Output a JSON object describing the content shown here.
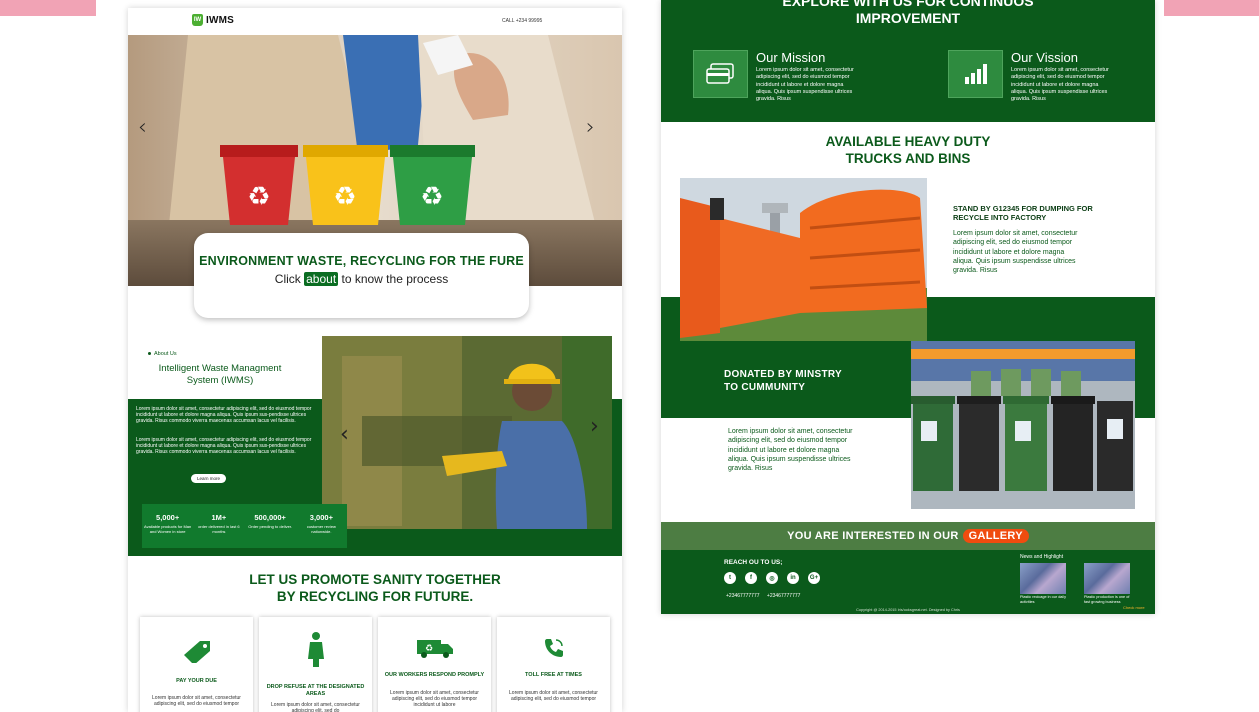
{
  "colors": {
    "brand_green": "#0b5a1b",
    "accent_orange": "#f04c0f",
    "band_green": "#4d7d43",
    "pink_bar": "#f1a3b5"
  },
  "left_page": {
    "nav": {
      "logo_text": "IWMS",
      "logo_mark": "IW",
      "call": "CALL +234 99995"
    },
    "hero": {
      "prev_arrow": "‹",
      "next_arrow": "›",
      "title": "ENVIRONMENT WASTE, RECYCLING FOR THE FURE",
      "sub_before": "Click ",
      "sub_highlight": "about",
      "sub_after": " to know the process"
    },
    "about": {
      "tag": "About Us",
      "title": "Intelligent Waste Managment System (IWMS)",
      "para1": "Lorem ipsum dolor sit amet, consectetur adipiscing elit, sed do eiusmod tempor incididunt ut labore et dolore magna aliqua. Quis ipsum sus-pendisse ultrices gravida. Risus commodo viverra maecenas accumsan lacus vel facilisis.",
      "para2": "Lorem ipsum dolor sit amet, consectetur adipiscing elit, sed do eiusmod tempor incididunt ut labore et dolore magna aliqua. Quis ipsum sus-pendisse ultrices gravida. Risus commodo viverra maecenas accumsan lacus vel facilisis.",
      "learn_more": "Learn more",
      "stats": [
        {
          "num": "5,000+",
          "label": "Available products for Man and Women in store"
        },
        {
          "num": "1M+",
          "label": "order delivered in last 6 months"
        },
        {
          "num": "500,000+",
          "label": "Order pending to deliver."
        },
        {
          "num": "3,000+",
          "label": "customer review nationwide."
        }
      ]
    },
    "promote": {
      "line1": "LET US PROMOTE SANITY TOGETHER",
      "line2": "BY RECYCLING FOR FUTURE."
    },
    "cards": [
      {
        "icon": "tag-icon",
        "title": "PAY YOUR DUE",
        "text": "Lorem ipsum dolor sit amet, consectetur adipiscing elit, sed do eiusmod tempor"
      },
      {
        "icon": "person-icon",
        "title": "DROP REFUSE AT THE DESIGNATED AREAS",
        "text": "Lorem ipsum dolor sit amet, consectetur adipiscing elit, sed do"
      },
      {
        "icon": "recycle-truck-icon",
        "title": "OUR WORKERS RESPOND PROMPLY",
        "text": "Lorem ipsum dolor sit amet, consectetur adipiscing elit, sed do eiusmod tempor incididunt ut labore"
      },
      {
        "icon": "phone-icon",
        "title": "TOLL FREE AT TIMES",
        "text": "Lorem ipsum dolor sit amet, consectetur adipiscing elit, sed do eiusmod tempor"
      }
    ]
  },
  "right_page": {
    "explore": {
      "line1": "EXPLORE WITH US FOR CONTINUOS",
      "line2": "IMPROVEMENT"
    },
    "mission": {
      "title": "Our Mission",
      "text": "Lorem ipsum dolor sit amet, consectetur adipiscing elit, sed do eiusmod tempor incididunt ut labore et dolore magna aliqua. Quis ipsum suspendisse ultrices gravida. Risus"
    },
    "vision": {
      "title": "Our Vission",
      "text": "Lorem ipsum dolor sit amet, consectetur adipiscing elit, sed do eiusmod tempor incididunt ut labore et dolore magna aliqua. Quis ipsum suspendisse ultrices gravida. Risus"
    },
    "available": {
      "line1": "AVAILABLE HEAVY DUTY",
      "line2": "TRUCKS AND BINS"
    },
    "stand": {
      "title": "STAND BY G12345 FOR DUMPING FOR RECYCLE INTO FACTORY",
      "text": "Lorem ipsum dolor sit amet, consectetur adipiscing elit, sed do eiusmod tempor incididunt ut labore et dolore magna aliqua. Quis ipsum suspendisse ultrices gravida. Risus"
    },
    "donated": {
      "line1": "DONATED BY MINSTRY",
      "line2": "TO CUMMUNITY",
      "text": "Lorem ipsum dolor sit amet, consectetur adipiscing elit, sed do eiusmod tempor incididunt ut labore et dolore magna aliqua. Quis ipsum suspendisse ultrices gravida. Risus"
    },
    "gallery": {
      "text": "YOU ARE INTERESTED IN OUR",
      "button": "GALLERY"
    },
    "footer": {
      "reach": "REACH OU TO US;",
      "socials": [
        "t",
        "f",
        "◎",
        "in",
        "G+"
      ],
      "phone1": "+23467777777",
      "phone2": "+23467777777",
      "news_title": "News and Highlight",
      "news": [
        {
          "text": "Plastic recicage in our daily activities"
        },
        {
          "text": "Plastic production is one of fast growing business"
        }
      ],
      "check_more": "Check more",
      "copyright": "Copyright @ 2014-2015 Iris/ooksgreat.net. Designed by Chris"
    }
  }
}
